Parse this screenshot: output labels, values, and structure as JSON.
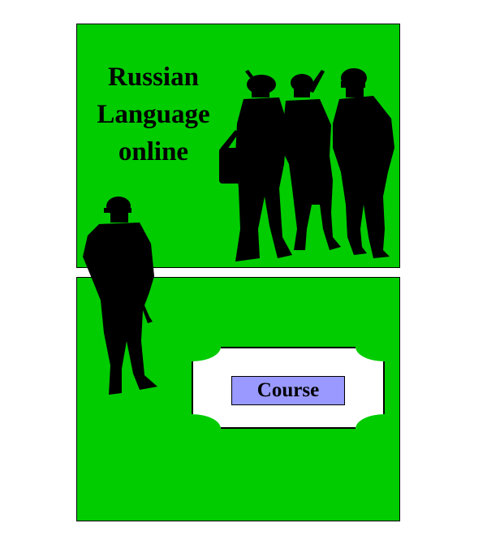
{
  "title": {
    "line1": "Russian",
    "line2": "Language",
    "line3": "online"
  },
  "course_button": {
    "label": "Course"
  },
  "colors": {
    "background": "#ffffff",
    "panel_green": "#00cc00",
    "button_fill": "#9999ff",
    "silhouette": "#000000"
  },
  "images": [
    "soldiers-group-silhouette",
    "soldier-silhouette"
  ]
}
